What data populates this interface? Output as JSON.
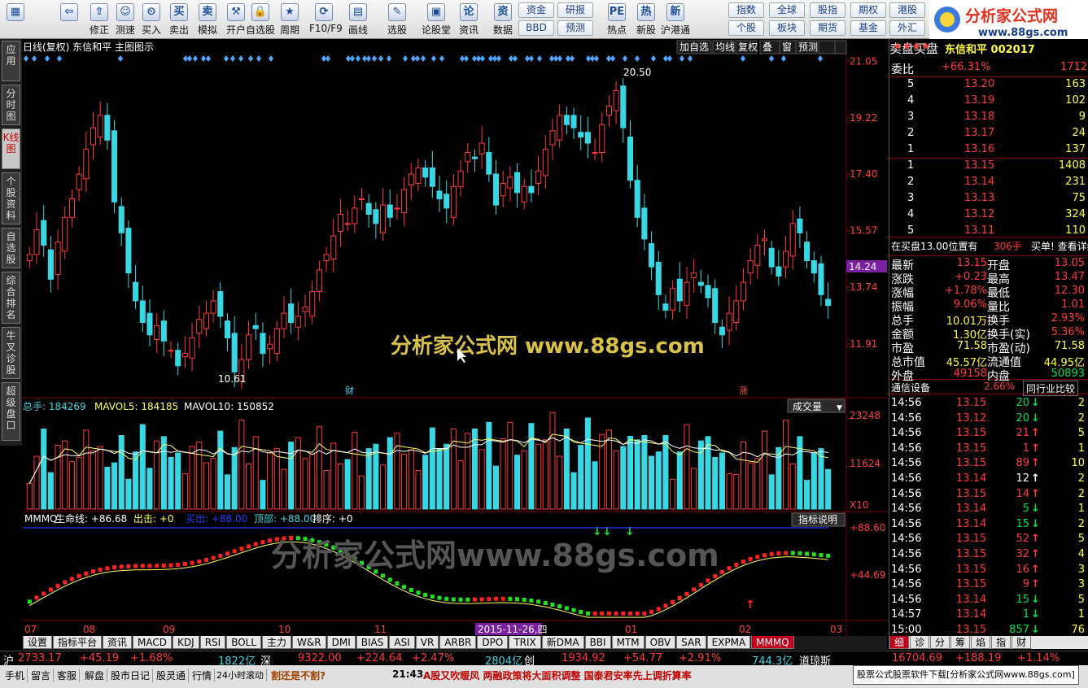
{
  "toolbar": {
    "buttons": [
      "",
      "",
      "修正",
      "测速",
      "买入",
      "卖出",
      "模拟",
      "开户",
      "自选股",
      "周期",
      "F10/F9",
      "画线",
      "选股",
      "论股堂",
      "资讯",
      "数据",
      "热点",
      "新股",
      "沪港通"
    ],
    "quick": [
      "资金",
      "研报",
      "BBD",
      "预测",
      "指数",
      "全球",
      "股指",
      "期权",
      "港股",
      "个股",
      "板块",
      "期货",
      "基金",
      "外汇"
    ]
  },
  "logo": {
    "text": "分析家公式网",
    "url": "www.88gs.com"
  },
  "left_tabs": [
    "应用",
    "分时图",
    "K线图",
    "个股资料",
    "自选股",
    "综合排名",
    "牛叉诊股",
    "超级盘口"
  ],
  "main": {
    "title": "日线(复权)  东信和平  主图图示",
    "right_btns": [
      "加自选",
      "均线",
      "复权",
      "叠",
      "窗",
      "预测",
      "",
      ""
    ],
    "ticks": [
      "21.05",
      "19.22",
      "17.40",
      "15.57",
      "13.74",
      "11.91"
    ],
    "current_price": "14.24",
    "high_label": "20.50",
    "low_label": "10.61",
    "marker_cai": "财",
    "marker_zhang": "涨"
  },
  "watermark1": "分析家公式网  www.88gs.com",
  "watermark2": "分析家公式网www.88gs.com",
  "vol": {
    "label_total": "总手: 184269",
    "label_ma5": "MAVOL5: 184185",
    "label_ma10": "MAVOL10: 150852",
    "dropdown": "成交量",
    "ticks": [
      "23248",
      "11624",
      "X10"
    ]
  },
  "mmmq": {
    "name": "MMMQ",
    "life": "生命线: +86.68",
    "out": "出击: +0",
    "buy": "买出: +88.00",
    "top": "顶部: +88.00",
    "sort": "排序: +0",
    "button": "指标说明",
    "ticks": [
      "+88.60",
      "+44.69"
    ]
  },
  "xaxis": {
    "labels": [
      "07",
      "08",
      "09",
      "10",
      "11",
      "01",
      "02",
      "03"
    ],
    "date_box": "2015-11-26,四"
  },
  "bottom_tabs": [
    "设置",
    "指标平台",
    "资讯",
    "MACD",
    "KDJ",
    "RSI",
    "BOLL",
    "主力",
    "W&R",
    "DMI",
    "BIAS",
    "ASI",
    "VR",
    "ARBR",
    "DPO",
    "TRIX",
    "新DMA",
    "BBI",
    "MTM",
    "OBV",
    "SAR",
    "EXPMA",
    "MMMQ"
  ],
  "right": {
    "stars": "★★★★",
    "name": "东信和平  002017",
    "weibi_label": "委比",
    "weibi_val": "+66.31%",
    "weibi_num": "1712",
    "sell": [
      [
        "5",
        "13.20",
        "163"
      ],
      [
        "4",
        "13.19",
        "102"
      ],
      [
        "3",
        "13.18",
        "9"
      ],
      [
        "2",
        "13.17",
        "24"
      ],
      [
        "1",
        "13.16",
        "137"
      ]
    ],
    "buy": [
      [
        "1",
        "13.15",
        "1408"
      ],
      [
        "2",
        "13.14",
        "231"
      ],
      [
        "3",
        "13.13",
        "75"
      ],
      [
        "4",
        "13.12",
        "324"
      ],
      [
        "5",
        "13.11",
        "110"
      ]
    ],
    "sell_label": "卖盘",
    "buy_label": "买盘",
    "info": "在买盘13.00位置有",
    "info_num": "306手",
    "info_tail": "买单! 查看详细",
    "stats": [
      [
        "最新",
        "13.15",
        "开盘",
        "13.05"
      ],
      [
        "涨跌",
        "+0.23",
        "最高",
        "13.47"
      ],
      [
        "涨幅",
        "+1.78%",
        "最低",
        "12.30"
      ],
      [
        "振幅",
        "9.06%",
        "量比",
        "1.01"
      ],
      [
        "总手",
        "10.01万",
        "换手",
        "2.93%"
      ],
      [
        "金额",
        "1.30亿",
        "换手(实)",
        "5.36%"
      ],
      [
        "市盈",
        "71.58",
        "市盈(动)",
        "71.58"
      ],
      [
        "总市值",
        "45.57亿",
        "流通值",
        "44.95亿"
      ],
      [
        "外盘",
        "49158",
        "内盘",
        "50893"
      ]
    ],
    "industry": "通信设备",
    "industry_pct": "2.66%",
    "compare_btn": "同行业比较",
    "ticks": [
      [
        "14:56",
        "13.15",
        "20",
        "↓",
        "2"
      ],
      [
        "14:56",
        "13.12",
        "20",
        "↓",
        "2"
      ],
      [
        "14:56",
        "13.15",
        "21",
        "↑",
        "5"
      ],
      [
        "14:56",
        "13.15",
        "1",
        "↑",
        "1"
      ],
      [
        "14:56",
        "13.15",
        "89",
        "↑",
        "10"
      ],
      [
        "14:56",
        "13.14",
        "12",
        "↑",
        "2"
      ],
      [
        "14:56",
        "13.15",
        "14",
        "↑",
        "2"
      ],
      [
        "14:56",
        "13.14",
        "5",
        "↓",
        "1"
      ],
      [
        "14:56",
        "13.14",
        "15",
        "↓",
        "2"
      ],
      [
        "14:56",
        "13.15",
        "52",
        "↑",
        "5"
      ],
      [
        "14:56",
        "13.15",
        "32",
        "↑",
        "4"
      ],
      [
        "14:56",
        "13.15",
        "16",
        "↑",
        "3"
      ],
      [
        "14:56",
        "13.15",
        "9",
        "↑",
        "3"
      ],
      [
        "14:56",
        "13.14",
        "15",
        "↓",
        "5"
      ],
      [
        "14:57",
        "13.14",
        "1",
        "↓",
        "1"
      ],
      [
        "15:00",
        "13.15",
        "857",
        "↓",
        "76"
      ]
    ],
    "tabs": [
      "细",
      "诊",
      "分",
      "筹",
      "焰",
      "指",
      "财"
    ]
  },
  "indexbar": {
    "sh": "沪",
    "sh_val": "2733.17",
    "sh_chg": "+45.19",
    "sh_pct": "+1.68%",
    "sh_amt": "1822亿",
    "sz": "深",
    "sz_val": "9322.00",
    "sz_chg": "+224.64",
    "sz_pct": "+2.47%",
    "sz_amt": "2804亿",
    "cy": "创",
    "cy_val": "1934.92",
    "cy_chg": "+54.77",
    "cy_pct": "+2.91%",
    "cy_amt": "744.3亿",
    "dj": "道琼斯",
    "dj_val": "16704.69",
    "dj_chg": "+188.19",
    "dj_pct": "+1.14%"
  },
  "status": {
    "items": [
      "手机",
      "留言",
      "客服",
      "解盘",
      "股市日记",
      "股灵通",
      "行情",
      "24小时滚动"
    ],
    "question": "割还是不割?",
    "time": "21:43",
    "news": "A股又吹暖风 两融政策将大面积调整 国泰君安率先上调折算率",
    "ad": "股票公式股票软件下载[分析家公式网www.88gs.com]"
  }
}
